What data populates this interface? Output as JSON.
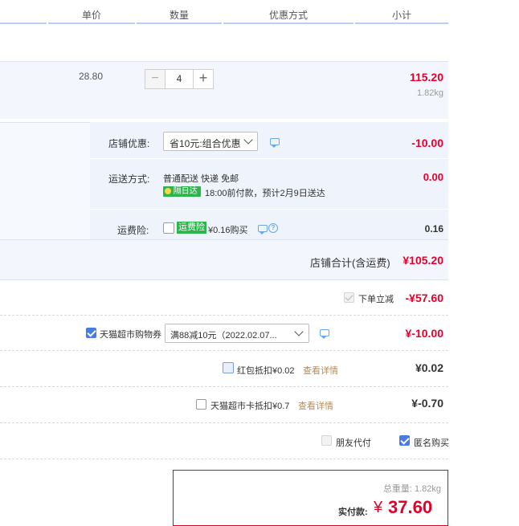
{
  "header": {
    "columns": [
      "单价",
      "数量",
      "优惠方式",
      "小计"
    ]
  },
  "item": {
    "unit_price": "28.80",
    "quantity": "4",
    "subtotal": "115.20",
    "weight": "1.82kg"
  },
  "shop_discount": {
    "label": "店铺优惠:",
    "selected": "省10元:组合优惠",
    "amount": "-10.00"
  },
  "shipping": {
    "label": "运送方式:",
    "method": "普通配送 快递 免邮",
    "badge": "隔日达",
    "note": "18:00前付款，预计2月9日送达",
    "amount": "0.00"
  },
  "insurance": {
    "label": "运费险:",
    "tag": "运费险",
    "price_text": "¥0.16购买",
    "amount": "0.16"
  },
  "shop_total": {
    "label": "店铺合计(含运费)",
    "amount": "¥105.20"
  },
  "instant_discount": {
    "label": "下单立减",
    "amount": "-¥57.60"
  },
  "coupon": {
    "label": "天猫超市购物券",
    "selected": "满88减10元（2022.02.07...",
    "amount": "¥-10.00"
  },
  "red_packet": {
    "label": "红包抵扣¥0.02",
    "link": "查看详情",
    "amount": "¥0.02"
  },
  "card": {
    "label": "天猫超市卡抵扣¥0.7",
    "link": "查看详情",
    "amount": "¥-0.70"
  },
  "options": {
    "friend_pay": "朋友代付",
    "anonymous": "匿名购买"
  },
  "summary": {
    "weight_label": "总重量:",
    "weight_value": "1.82kg",
    "pay_label": "实付款:",
    "currency": "¥",
    "amount": "37.60"
  },
  "colors": {
    "accent_red": "#e4002b",
    "blue_bg": "#f3f7fd",
    "check_blue": "#4a7be3",
    "link_brown": "#b38b5e"
  }
}
